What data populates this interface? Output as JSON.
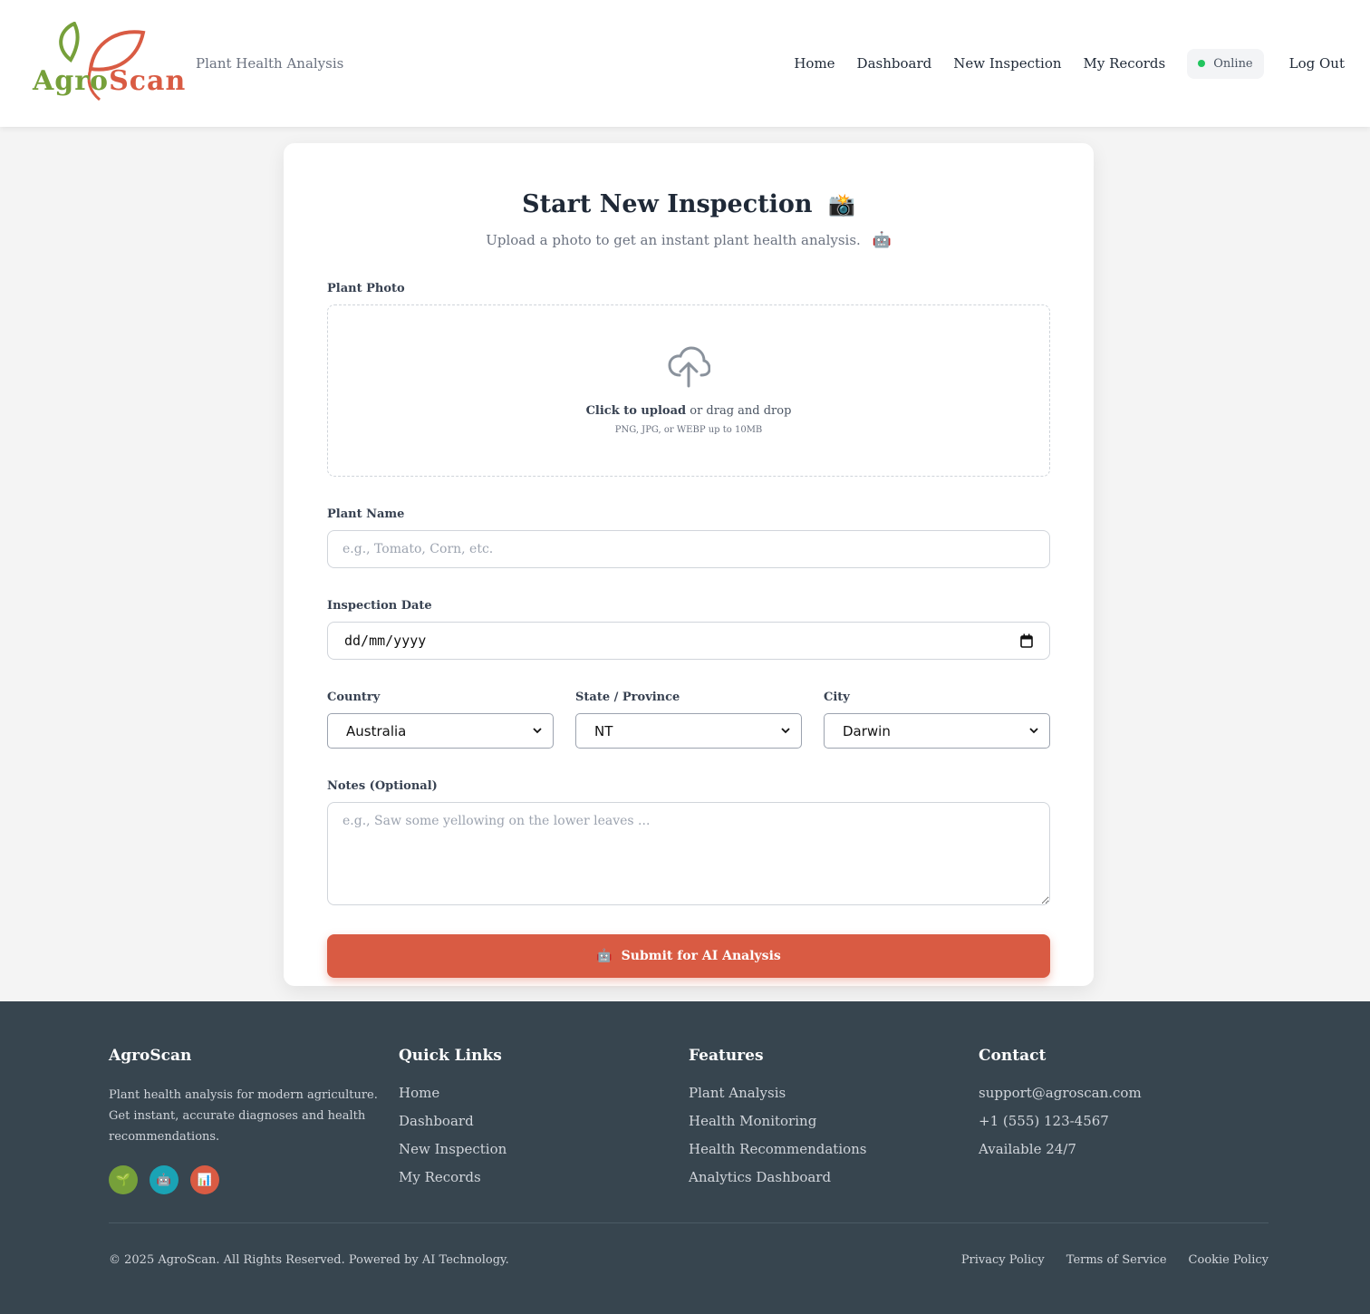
{
  "brand": {
    "name_part1": "Agro",
    "name_part2": "Scan",
    "tagline": "Plant Health Analysis",
    "leaf_green": "#76a03a",
    "accent": "#d95b43"
  },
  "nav": {
    "home": "Home",
    "dashboard": "Dashboard",
    "new_inspection": "New Inspection",
    "my_records": "My Records",
    "status": "Online",
    "logout": "Log Out"
  },
  "form": {
    "title": "Start New Inspection",
    "title_emoji": "📸",
    "subtitle": "Upload a photo to get an instant plant health analysis.",
    "subtitle_emoji": "🤖",
    "photo_label": "Plant Photo",
    "upload_strong": "Click to upload",
    "upload_rest": " or drag and drop",
    "upload_hint": "PNG, JPG, or WEBP up to 10MB",
    "plant_name_label": "Plant Name",
    "plant_name_placeholder": "e.g., Tomato, Corn, etc.",
    "date_label": "Inspection Date",
    "date_value": "dd/mm/yyyy",
    "country_label": "Country",
    "country_value": "Australia",
    "state_label": "State / Province",
    "state_value": "NT",
    "city_label": "City",
    "city_value": "Darwin",
    "notes_label": "Notes (Optional)",
    "notes_placeholder": "e.g., Saw some yellowing on the lower leaves ...",
    "submit_emoji": "🤖",
    "submit_label": "Submit for AI Analysis"
  },
  "footer": {
    "brand": "AgroScan",
    "desc": "Plant health analysis for modern agriculture. Get instant, accurate diagnoses and health recommendations.",
    "badges": [
      {
        "icon": "🌱",
        "color": "#76a03a"
      },
      {
        "icon": "🤖",
        "color": "#1aa3b5"
      },
      {
        "icon": "📊",
        "color": "#d95b43"
      }
    ],
    "quick_links_title": "Quick Links",
    "quick_links": [
      "Home",
      "Dashboard",
      "New Inspection",
      "My Records"
    ],
    "features_title": "Features",
    "features": [
      "Plant Analysis",
      "Health Monitoring",
      "Health Recommendations",
      "Analytics Dashboard"
    ],
    "contact_title": "Contact",
    "contact": [
      "support@agroscan.com",
      "+1 (555) 123-4567",
      "Available 24/7"
    ],
    "copyright": "© 2025 AgroScan. All Rights Reserved. Powered by AI Technology.",
    "legal": [
      "Privacy Policy",
      "Terms of Service",
      "Cookie Policy"
    ]
  }
}
